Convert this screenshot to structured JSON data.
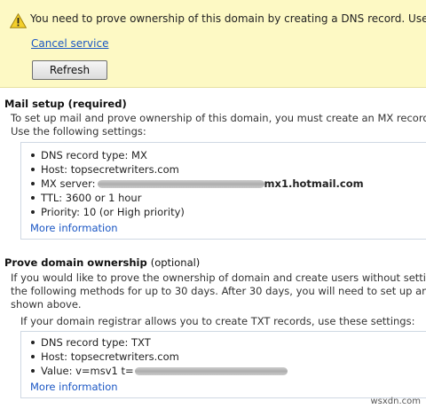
{
  "banner": {
    "message": "You need to prove ownership of this domain by creating a DNS record. Use the s",
    "cancel_link": "Cancel service",
    "refresh_label": "Refresh",
    "background_color": "#fdf9c4"
  },
  "mail_setup": {
    "heading": "Mail setup (required)",
    "intro_line1": "To set up mail and prove ownership of this domain, you must create an MX record through your",
    "intro_line2": "Use the following settings:",
    "items": [
      "DNS record type: MX",
      "Host: topsecretwriters.com",
      "MX server:",
      "TTL: 3600 or 1 hour",
      "Priority: 10 (or High priority)"
    ],
    "mx_server_suffix": "mx1.hotmail.com",
    "more_info": "More information"
  },
  "prove_ownership": {
    "heading": "Prove domain ownership",
    "heading_suffix": "(optional)",
    "intro_line1": "If you would like to prove the ownership of domain and create users without setting up mail, you",
    "intro_line2": "the following methods for up to 30 days. After 30 days, you will need to set up an MX record fo",
    "intro_line3": "shown above.",
    "txt_intro": "If your domain registrar allows you to create TXT records, use these settings:",
    "items": [
      "DNS record type: TXT",
      "Host: topsecretwriters.com",
      "Value: v=msv1 t="
    ],
    "more_info": "More information"
  },
  "watermark": "wsxdn.com",
  "link_color": "#1a56c4"
}
